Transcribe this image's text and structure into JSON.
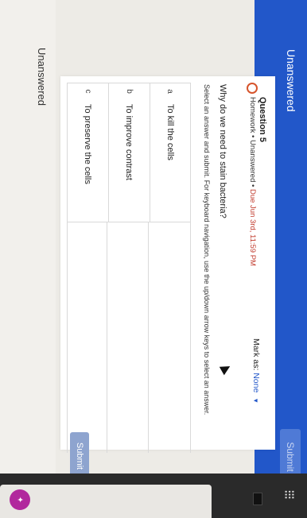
{
  "header": {
    "unanswered_label": "Unanswered",
    "submit_label": "Submit"
  },
  "question": {
    "title": "Question 5",
    "category": "Homework",
    "status": "Unanswered",
    "due": "Due Jun 3rd, 11:59 PM",
    "mark_as_label": "Mark as:",
    "mark_as_value": "None",
    "prompt": "Why do we need to stain bacteria?",
    "instructions": "Select an answer and submit. For keyboard navigation, use the up/down arrow keys to select an answer."
  },
  "options": [
    {
      "letter": "a",
      "text": "To kill the cells"
    },
    {
      "letter": "b",
      "text": "To improve contrast"
    },
    {
      "letter": "c",
      "text": "To preserve the cells"
    }
  ],
  "footer": {
    "submit_label": "Submit",
    "unanswered_label": "Unanswered"
  },
  "colors": {
    "brand_blue": "#2257c9",
    "due_red": "#c0392b",
    "avatar_purple": "#b1289d"
  },
  "icons": [
    "status-ring-icon",
    "chevron-down-icon",
    "mouse-cursor-icon",
    "grid-menu-icon",
    "avatar-icon"
  ]
}
